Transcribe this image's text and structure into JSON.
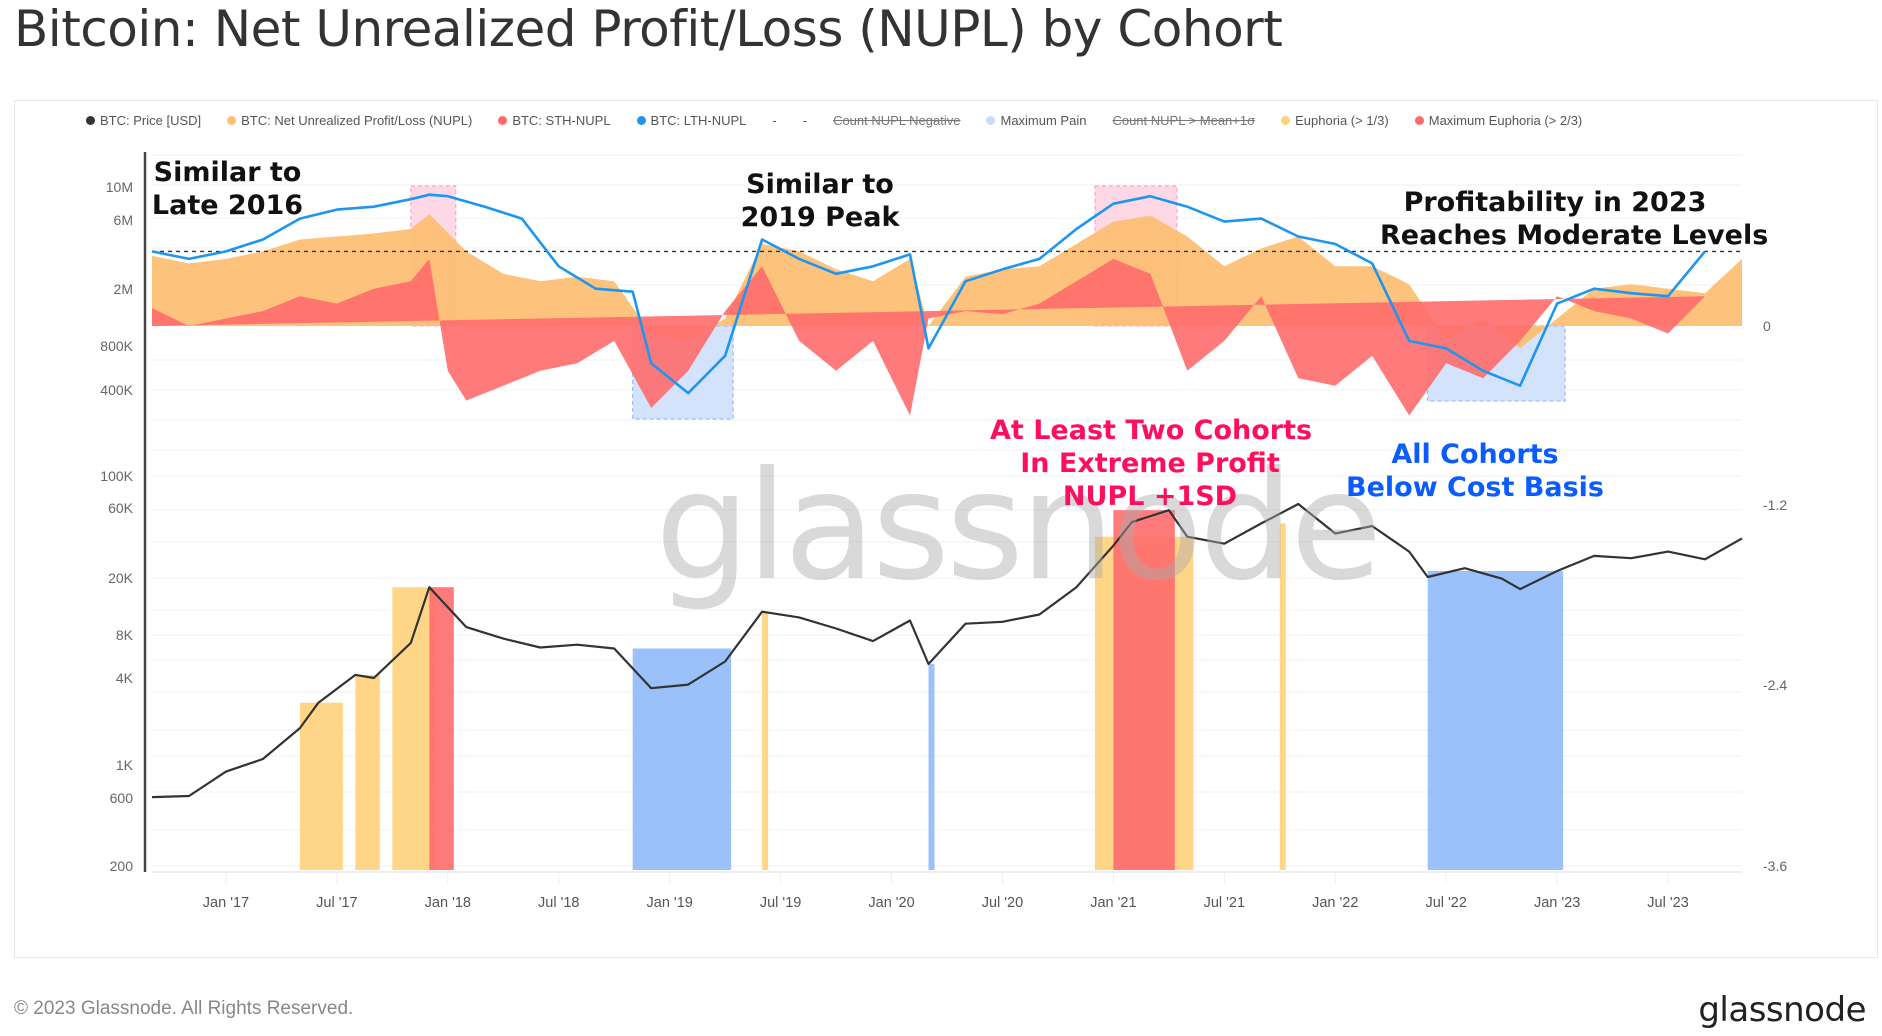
{
  "title": "Bitcoin: Net Unrealized Profit/Loss (NUPL) by Cohort",
  "footer": {
    "copyright": "© 2023 Glassnode. All Rights Reserved.",
    "logo": "glassnode"
  },
  "watermark": "glassnode",
  "legend": [
    {
      "label": "BTC: Price [USD]",
      "color": "#333333",
      "struck": false
    },
    {
      "label": "BTC: Net Unrealized Profit/Loss (NUPL)",
      "color": "#fdbf75",
      "struck": false
    },
    {
      "label": "BTC: STH-NUPL",
      "color": "#ff6b6b",
      "struck": false
    },
    {
      "label": "BTC: LTH-NUPL",
      "color": "#1e96f0",
      "struck": false
    },
    {
      "label": "-",
      "color": null,
      "struck": false
    },
    {
      "label": "-",
      "color": null,
      "struck": false
    },
    {
      "label": "Count NUPL Negative",
      "color": null,
      "struck": true
    },
    {
      "label": "Maximum Pain",
      "color": "#c9dcfb",
      "struck": false
    },
    {
      "label": "Count NUPL > Mean+1σ",
      "color": null,
      "struck": true
    },
    {
      "label": "Euphoria (> 1/3)",
      "color": "#ffd27a",
      "struck": false
    },
    {
      "label": "Maximum Euphoria (> 2/3)",
      "color": "#ff6b6b",
      "struck": false
    }
  ],
  "annotations": [
    {
      "text": [
        "Similar to",
        "Late 2016"
      ],
      "color": "#111111"
    },
    {
      "text": [
        "Similar to",
        "2019 Peak"
      ],
      "color": "#111111"
    },
    {
      "text": [
        "Profitability in 2023",
        "Reaches Moderate Levels"
      ],
      "color": "#111111"
    },
    {
      "text": [
        "At Least Two Cohorts",
        "In Extreme Profit",
        "NUPL +1SD"
      ],
      "color": "#ff0f5b"
    },
    {
      "text": [
        "All Cohorts",
        "Below Cost Basis"
      ],
      "color": "#0a5cff"
    }
  ],
  "chart_data": {
    "type": "line",
    "title": "Bitcoin: Net Unrealized Profit/Loss (NUPL) by Cohort",
    "x_ticks": [
      "Jan '17",
      "Jul '17",
      "Jan '18",
      "Jul '18",
      "Jan '19",
      "Jul '19",
      "Jan '20",
      "Jul '20",
      "Jan '21",
      "Jul '21",
      "Jan '22",
      "Jul '22",
      "Jan '23",
      "Jul '23"
    ],
    "x_range": [
      "2016-09",
      "2023-11"
    ],
    "y_left_ticks": [
      "10M",
      "6M",
      "2M",
      "800K",
      "400K",
      "100K",
      "60K",
      "20K",
      "8K",
      "4K",
      "1K",
      "600",
      "200"
    ],
    "y_left_scale": "log",
    "y_left_label": "BTC: Price [USD]",
    "y_right_ticks": [
      "0",
      "-1.2",
      "-2.4",
      "-3.6"
    ],
    "y_right_range": [
      -3.6,
      1.0
    ],
    "nupl_reference_line": 0.5,
    "legend_position": "top",
    "grid": true,
    "series": [
      {
        "name": "BTC: Price [USD]",
        "type": "line",
        "color": "#333333",
        "x": [
          "2016-09",
          "2016-11",
          "2017-01",
          "2017-03",
          "2017-05",
          "2017-06",
          "2017-08",
          "2017-09",
          "2017-11",
          "2017-12",
          "2018-02",
          "2018-04",
          "2018-06",
          "2018-08",
          "2018-10",
          "2018-12",
          "2019-02",
          "2019-04",
          "2019-06",
          "2019-08",
          "2019-10",
          "2019-12",
          "2020-02",
          "2020-03",
          "2020-05",
          "2020-07",
          "2020-09",
          "2020-11",
          "2021-01",
          "2021-02",
          "2021-04",
          "2021-05",
          "2021-07",
          "2021-09",
          "2021-11",
          "2022-01",
          "2022-03",
          "2022-05",
          "2022-06",
          "2022-08",
          "2022-10",
          "2022-11",
          "2023-01",
          "2023-03",
          "2023-05",
          "2023-07",
          "2023-09",
          "2023-11"
        ],
        "values": [
          600,
          610,
          900,
          1100,
          1800,
          2700,
          4200,
          4000,
          7000,
          17000,
          9000,
          7500,
          6500,
          6800,
          6400,
          3400,
          3600,
          5200,
          11500,
          10500,
          8800,
          7200,
          10000,
          5000,
          9500,
          9800,
          11000,
          17000,
          33000,
          48000,
          58000,
          38000,
          34000,
          47000,
          64000,
          40000,
          45000,
          30000,
          20000,
          23000,
          19500,
          16500,
          22000,
          28000,
          27000,
          30000,
          26500,
          37000
        ]
      },
      {
        "name": "BTC: Net Unrealized Profit/Loss (NUPL)",
        "type": "area",
        "color": "#fdbf75",
        "x": [
          "2016-09",
          "2016-11",
          "2017-01",
          "2017-03",
          "2017-05",
          "2017-07",
          "2017-09",
          "2017-11",
          "2017-12",
          "2018-02",
          "2018-04",
          "2018-06",
          "2018-08",
          "2018-10",
          "2018-12",
          "2019-02",
          "2019-04",
          "2019-06",
          "2019-08",
          "2019-10",
          "2019-12",
          "2020-02",
          "2020-03",
          "2020-05",
          "2020-07",
          "2020-09",
          "2020-11",
          "2021-01",
          "2021-03",
          "2021-05",
          "2021-07",
          "2021-09",
          "2021-11",
          "2022-01",
          "2022-03",
          "2022-05",
          "2022-07",
          "2022-09",
          "2022-11",
          "2023-01",
          "2023-03",
          "2023-05",
          "2023-07",
          "2023-09",
          "2023-11"
        ],
        "values": [
          0.47,
          0.42,
          0.45,
          0.5,
          0.58,
          0.6,
          0.62,
          0.65,
          0.75,
          0.5,
          0.35,
          0.3,
          0.33,
          0.3,
          -0.05,
          -0.1,
          0.05,
          0.55,
          0.5,
          0.38,
          0.3,
          0.45,
          0.0,
          0.33,
          0.38,
          0.4,
          0.55,
          0.7,
          0.74,
          0.6,
          0.4,
          0.52,
          0.6,
          0.4,
          0.4,
          0.28,
          -0.1,
          0.05,
          -0.15,
          0.05,
          0.25,
          0.28,
          0.25,
          0.22,
          0.45
        ]
      },
      {
        "name": "BTC: STH-NUPL",
        "type": "area",
        "color": "#ff6b6b",
        "x": [
          "2016-09",
          "2016-11",
          "2017-01",
          "2017-03",
          "2017-05",
          "2017-07",
          "2017-09",
          "2017-11",
          "2017-12",
          "2018-01",
          "2018-02",
          "2018-04",
          "2018-06",
          "2018-08",
          "2018-10",
          "2018-12",
          "2019-02",
          "2019-04",
          "2019-06",
          "2019-08",
          "2019-10",
          "2019-12",
          "2020-02",
          "2020-03",
          "2020-05",
          "2020-07",
          "2020-09",
          "2020-11",
          "2021-01",
          "2021-03",
          "2021-05",
          "2021-07",
          "2021-09",
          "2021-11",
          "2022-01",
          "2022-03",
          "2022-05",
          "2022-07",
          "2022-09",
          "2022-11",
          "2023-01",
          "2023-03",
          "2023-05",
          "2023-07",
          "2023-09",
          "2023-11"
        ],
        "values": [
          0.12,
          0.0,
          0.05,
          0.1,
          0.2,
          0.15,
          0.25,
          0.3,
          0.45,
          -0.3,
          -0.5,
          -0.4,
          -0.3,
          -0.25,
          -0.1,
          -0.55,
          -0.3,
          0.1,
          0.4,
          -0.1,
          -0.3,
          -0.1,
          -0.6,
          0.05,
          0.1,
          0.08,
          0.15,
          0.3,
          0.45,
          0.35,
          -0.3,
          -0.1,
          0.2,
          -0.35,
          -0.4,
          -0.2,
          -0.6,
          -0.25,
          -0.35,
          -0.1,
          0.2,
          0.1,
          0.05,
          -0.05,
          0.2
        ]
      },
      {
        "name": "BTC: LTH-NUPL",
        "type": "line",
        "color": "#1e96f0",
        "x": [
          "2016-09",
          "2016-11",
          "2017-01",
          "2017-03",
          "2017-05",
          "2017-07",
          "2017-09",
          "2017-11",
          "2017-12",
          "2018-01",
          "2018-03",
          "2018-05",
          "2018-07",
          "2018-09",
          "2018-11",
          "2018-12",
          "2019-02",
          "2019-04",
          "2019-06",
          "2019-08",
          "2019-10",
          "2019-12",
          "2020-02",
          "2020-03",
          "2020-05",
          "2020-07",
          "2020-09",
          "2020-11",
          "2021-01",
          "2021-03",
          "2021-05",
          "2021-07",
          "2021-09",
          "2021-11",
          "2022-01",
          "2022-03",
          "2022-05",
          "2022-07",
          "2022-09",
          "2022-11",
          "2023-01",
          "2023-03",
          "2023-05",
          "2023-07",
          "2023-09",
          "2023-11"
        ],
        "values": [
          0.5,
          0.45,
          0.5,
          0.58,
          0.72,
          0.78,
          0.8,
          0.85,
          0.88,
          0.87,
          0.8,
          0.72,
          0.4,
          0.25,
          0.23,
          -0.25,
          -0.45,
          -0.2,
          0.58,
          0.45,
          0.35,
          0.4,
          0.48,
          -0.15,
          0.3,
          0.38,
          0.45,
          0.65,
          0.82,
          0.87,
          0.8,
          0.7,
          0.72,
          0.6,
          0.55,
          0.42,
          -0.1,
          -0.15,
          -0.3,
          -0.4,
          0.15,
          0.25,
          0.22,
          0.2,
          0.5
        ]
      },
      {
        "name": "Maximum Pain",
        "type": "shaded_region",
        "color": "#c9dcfb",
        "ranges": [
          [
            "2018-11",
            "2019-04"
          ],
          [
            "2022-06",
            "2023-01"
          ]
        ]
      },
      {
        "name": "Maximum Euphoria (> 2/3) zone",
        "type": "shaded_region",
        "color": "#ffc8dc",
        "ranges": [
          [
            "2017-11",
            "2018-01"
          ],
          [
            "2020-12",
            "2021-04"
          ]
        ]
      },
      {
        "name": "Euphoria (> 1/3)",
        "type": "bands",
        "color": "#ffd27a",
        "ranges": [
          [
            "2017-05",
            "2017-07"
          ],
          [
            "2017-08",
            "2017-09"
          ],
          [
            "2017-10",
            "2017-12"
          ],
          [
            "2019-06",
            "2019-06"
          ],
          [
            "2020-12",
            "2021-05"
          ],
          [
            "2021-10",
            "2021-10"
          ]
        ]
      },
      {
        "name": "Maximum Euphoria (> 2/3)",
        "type": "bands",
        "color": "#ff6b6b",
        "ranges": [
          [
            "2017-12",
            "2018-01"
          ],
          [
            "2021-01",
            "2021-04"
          ]
        ]
      },
      {
        "name": "Maximum Pain bands",
        "type": "bands",
        "color": "#8fbaf8",
        "ranges": [
          [
            "2018-11",
            "2019-04"
          ],
          [
            "2020-03",
            "2020-03"
          ],
          [
            "2022-06",
            "2023-01"
          ]
        ]
      }
    ]
  }
}
